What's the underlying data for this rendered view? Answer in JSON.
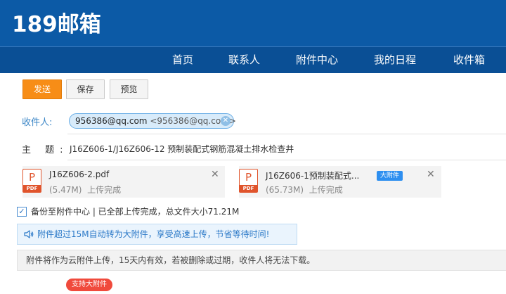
{
  "app": {
    "logo_text": "189邮箱"
  },
  "nav": {
    "items": [
      {
        "label": "首页"
      },
      {
        "label": "联系人"
      },
      {
        "label": "附件中心"
      },
      {
        "label": "我的日程"
      },
      {
        "label": "收件箱"
      }
    ]
  },
  "toolbar": {
    "send_label": "发送",
    "save_label": "保存",
    "preview_label": "预览"
  },
  "recipient": {
    "label": "收件人:",
    "chip_name": "956386@qq.com",
    "chip_address": "<956386@qq.com>",
    "remove_icon": "close-circle-icon"
  },
  "subject": {
    "label": "主  题:",
    "value": "J16Z606-1/J16Z606-12 预制装配式钢筋混凝土排水检查井"
  },
  "attachments": [
    {
      "name": "J16Z606-2.pdf",
      "size": "(5.47M)",
      "status": "上传完成",
      "icon_letter": "P",
      "icon_tag": "PDF",
      "badge": ""
    },
    {
      "name": "J16Z606-1预制装配式...",
      "size": "(65.73M)",
      "status": "上传完成",
      "icon_letter": "P",
      "icon_tag": "PDF",
      "badge": "大附件"
    }
  ],
  "backup": {
    "checked": true,
    "text": "备份至附件中心  |  已全部上传完成，总文件大小71.21M"
  },
  "info": {
    "icon": "speaker-icon",
    "text": "附件超过15M自动转为大附件，享受高速上传，节省等待时间!"
  },
  "notice": {
    "text": "附件将作为云附件上传，15天内有效，若被删除或过期，收件人将无法下载。"
  },
  "support_badge": {
    "text": "支持大附件"
  },
  "colors": {
    "header_bg": "#0c5aa6",
    "nav_bg": "#0a4f95",
    "send_button": "#f78d17",
    "badge_red": "#f04a3c",
    "big_badge_blue": "#2e8ff0"
  }
}
